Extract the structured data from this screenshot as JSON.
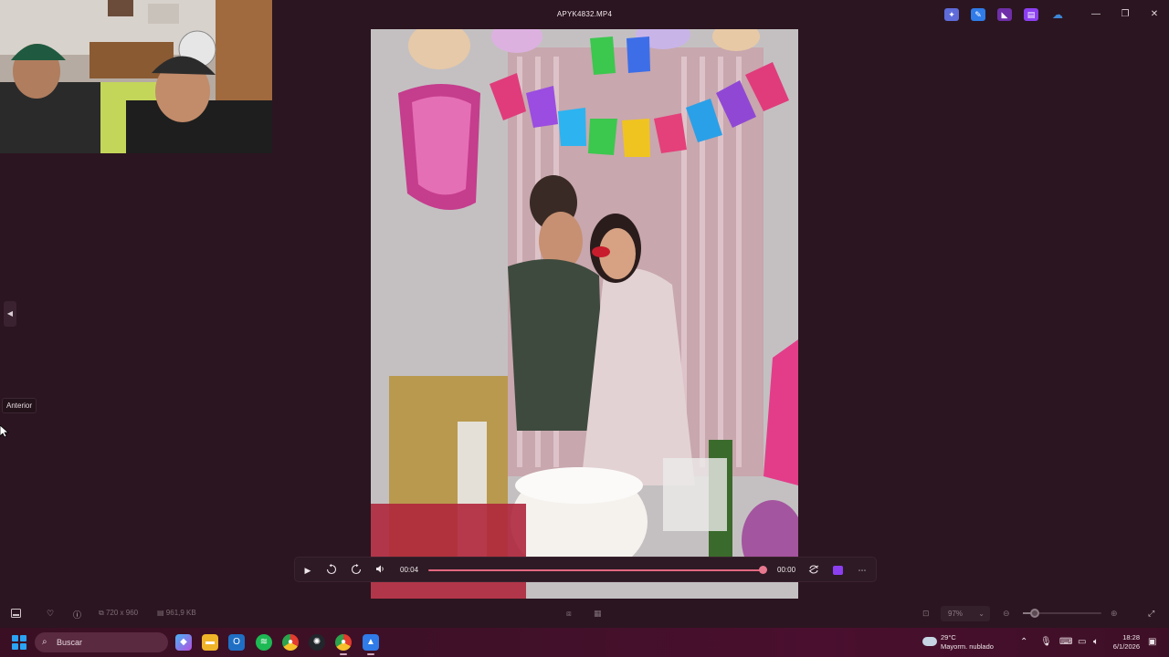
{
  "window": {
    "title": "APYK4832.MP4"
  },
  "title_icons": [
    {
      "name": "copilot-icon",
      "color": "#6b7cf0"
    },
    {
      "name": "image-editor-icon",
      "color": "#2f7be8"
    },
    {
      "name": "clipchamp-icon",
      "color": "#7b3fb6"
    },
    {
      "name": "video-editor-icon",
      "color": "#8b3ff0"
    },
    {
      "name": "onedrive-icon",
      "color": "#3e86d6"
    }
  ],
  "window_controls": {
    "minimize": "—",
    "restore": "❐",
    "close": "✕"
  },
  "sidebar": {
    "prev_arrow": "◀",
    "tooltip": "Anterior"
  },
  "player": {
    "current_time": "00:04",
    "end_time": "00:00",
    "progress": 1.0,
    "play_icon": "▶",
    "rewind_label": "10",
    "forward_label": "30"
  },
  "bottombar": {
    "dimensions": "720 x 960",
    "file_size": "961,9 KB",
    "zoom": "97%",
    "zoom_fraction": 0.15
  },
  "taskbar": {
    "search_placeholder": "Buscar",
    "weather_temp": "29°C",
    "weather_desc": "Mayorm. nublado",
    "time": "18:28",
    "date": "6/1/2026"
  },
  "colors": {
    "background": "#2b1520",
    "accent": "#e36882",
    "taskbar": "#3f1028"
  }
}
